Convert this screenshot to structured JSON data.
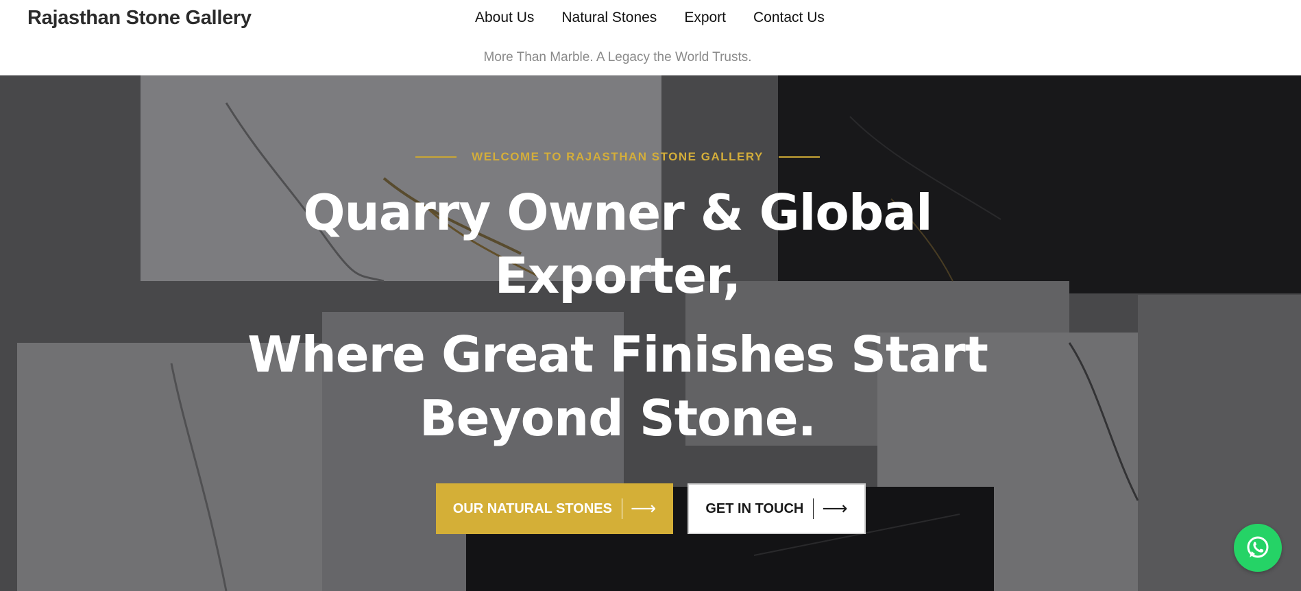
{
  "header": {
    "brand": "Rajasthan Stone Gallery",
    "nav": [
      {
        "label": "About Us"
      },
      {
        "label": "Natural Stones"
      },
      {
        "label": "Export"
      },
      {
        "label": "Contact Us"
      }
    ],
    "tagline": "More Than Marble. A Legacy the World Trusts."
  },
  "hero": {
    "eyebrow": "WELCOME TO RAJASTHAN STONE GALLERY",
    "headline_lines": [
      "Quarry Owner & Global",
      "Exporter,",
      "Where Great Finishes Start",
      "Beyond Stone."
    ],
    "primary_button": {
      "label": "OUR NATURAL STONES",
      "icon": "arrow-right-icon"
    },
    "secondary_button": {
      "label": "GET IN TOUCH",
      "icon": "arrow-right-icon"
    },
    "arrow_glyph": "⟶"
  },
  "floating": {
    "whatsapp_icon": "whatsapp-icon"
  },
  "colors": {
    "accent": "#d4af37",
    "eyebrow": "#d4ae3a",
    "whatsapp": "#25d366",
    "tagline": "#8a8a8a"
  }
}
